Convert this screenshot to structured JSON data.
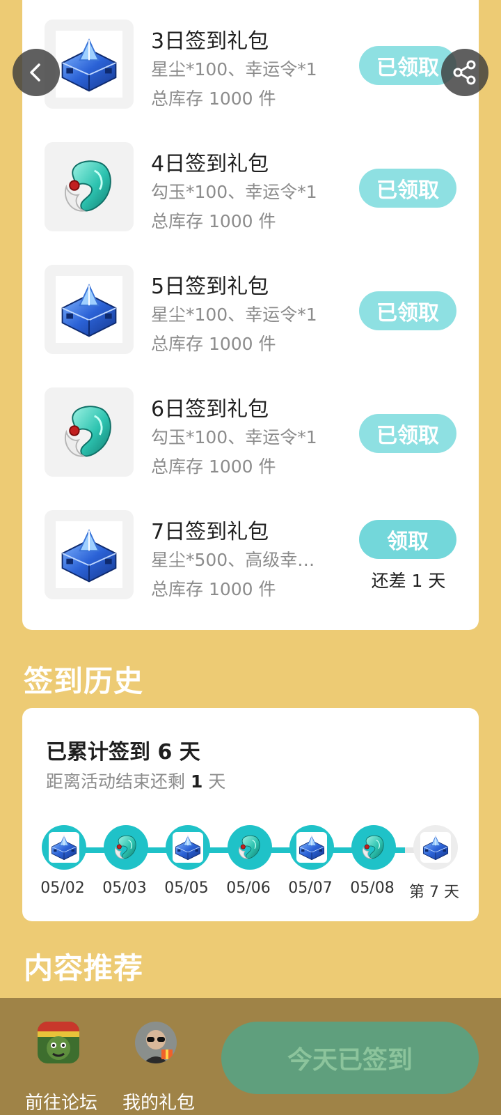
{
  "gifts": [
    {
      "name": "3日签到礼包",
      "desc": "星尘*100、幸运令*1",
      "stock": "总库存 1000 件",
      "button": "已领取",
      "icon": "crystal-box-icon"
    },
    {
      "name": "4日签到礼包",
      "desc": "勾玉*100、幸运令*1",
      "stock": "总库存 1000 件",
      "button": "已领取",
      "icon": "jade-magatama-icon"
    },
    {
      "name": "5日签到礼包",
      "desc": "星尘*100、幸运令*1",
      "stock": "总库存 1000 件",
      "button": "已领取",
      "icon": "crystal-box-icon"
    },
    {
      "name": "6日签到礼包",
      "desc": "勾玉*100、幸运令*1",
      "stock": "总库存 1000 件",
      "button": "已领取",
      "icon": "jade-magatama-icon"
    },
    {
      "name": "7日签到礼包",
      "desc": "星尘*500、高级幸…",
      "stock": "总库存 1000 件",
      "button": "领取",
      "remain": "还差 1 天",
      "icon": "crystal-box-icon"
    }
  ],
  "history": {
    "title": "签到历史",
    "total_prefix": "已累计签到",
    "total_days": "6",
    "total_suffix": "天",
    "remain_prefix": "距离活动结束还剩",
    "remain_days": "1",
    "remain_suffix": "天",
    "timeline": [
      {
        "label": "05/02",
        "icon": "crystal-box-icon",
        "done": true
      },
      {
        "label": "05/03",
        "icon": "jade-magatama-icon",
        "done": true
      },
      {
        "label": "05/05",
        "icon": "crystal-box-icon",
        "done": true
      },
      {
        "label": "05/06",
        "icon": "jade-magatama-icon",
        "done": true
      },
      {
        "label": "05/07",
        "icon": "crystal-box-icon",
        "done": true
      },
      {
        "label": "05/08",
        "icon": "jade-magatama-icon",
        "done": true
      },
      {
        "label": "第 7 天",
        "icon": "crystal-box-icon",
        "done": false
      }
    ]
  },
  "recommend_title": "内容推荐",
  "bottom": {
    "forum_label": "前往论坛",
    "gifts_label": "我的礼包",
    "checkin_button": "今天已签到"
  },
  "colors": {
    "background": "#EDCB74",
    "teal": "#1FC2C8",
    "claimed_button": "#8EE0E2",
    "bottom_bar": "#9F8347",
    "checkin_button": "#5F9F7D"
  }
}
